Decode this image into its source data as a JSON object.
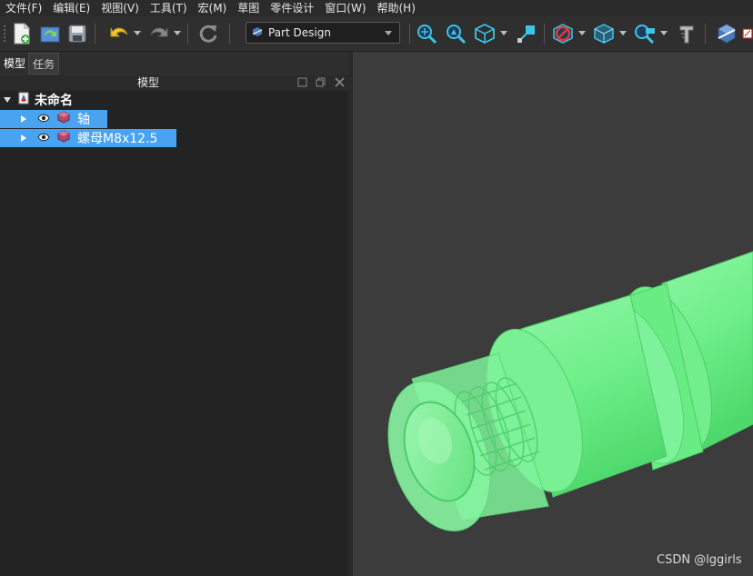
{
  "menubar": {
    "items": [
      "文件(F)",
      "编辑(E)",
      "视图(V)",
      "工具(T)",
      "宏(M)",
      "草图",
      "零件设计",
      "窗口(W)",
      "帮助(H)"
    ]
  },
  "toolbar": {
    "workbench": "Part Design"
  },
  "panel": {
    "tabs": [
      "模型",
      "任务"
    ],
    "header_title": "模型"
  },
  "tree": {
    "root_label": "未命名",
    "items": [
      {
        "label": "轴",
        "selected": true
      },
      {
        "label": "螺母M8x12.5",
        "selected": true
      }
    ]
  },
  "watermark": "CSDN @lggirls",
  "colors": {
    "selection": "#4aa3f0",
    "model_green": "#6ff08a",
    "viewport_bg": "#3c3c3c"
  }
}
